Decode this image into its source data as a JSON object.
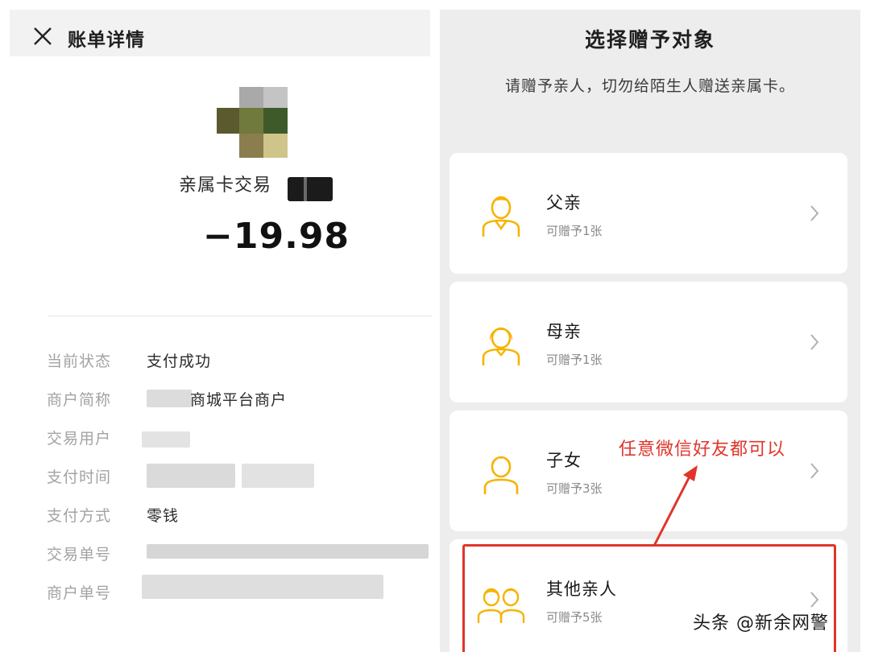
{
  "left_panel": {
    "title": "账单详情",
    "transaction_title": "亲属卡交易",
    "amount": "−19.98",
    "details": [
      {
        "label": "当前状态",
        "value": "支付成功"
      },
      {
        "label": "商户简称",
        "value": "商城平台商户"
      },
      {
        "label": "交易用户",
        "value": ""
      },
      {
        "label": "支付时间",
        "value": ""
      },
      {
        "label": "支付方式",
        "value": "零钱"
      },
      {
        "label": "交易单号",
        "value": ""
      },
      {
        "label": "商户单号",
        "value": ""
      }
    ]
  },
  "right_panel": {
    "title": "选择赠予对象",
    "subtitle": "请赠予亲人，切勿给陌生人赠送亲属卡。",
    "options": [
      {
        "name": "父亲",
        "quota": "可赠予1张",
        "icon": "father-icon"
      },
      {
        "name": "母亲",
        "quota": "可赠予1张",
        "icon": "mother-icon"
      },
      {
        "name": "子女",
        "quota": "可赠予3张",
        "icon": "child-icon"
      },
      {
        "name": "其他亲人",
        "quota": "可赠予5张",
        "icon": "relatives-icon"
      }
    ],
    "annotation": "任意微信好友都可以"
  },
  "watermark": "头条 @新余网警",
  "colors": {
    "icon_yellow": "#f5b400",
    "annotation_red": "#e0352b",
    "panel_gray": "#ededed"
  }
}
